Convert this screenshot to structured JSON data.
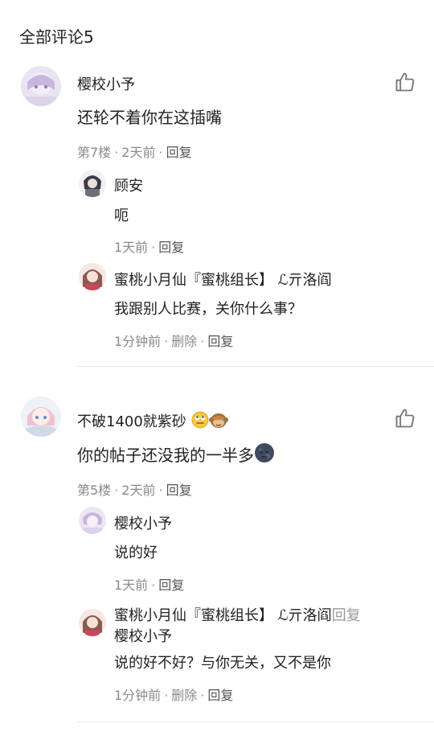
{
  "header": {
    "title": "全部评论5"
  },
  "comments": [
    {
      "user": "樱校小予",
      "text": "还轮不着你在这插嘴",
      "floor": "第7楼",
      "time": "2天前",
      "reply_label": "回复",
      "replies": [
        {
          "user": "顾安",
          "text": "呃",
          "time": "1天前",
          "reply_label": "回复"
        },
        {
          "user": "蜜桃小月仙『蜜桃组长】 ℒ亓洛阎",
          "text": "我跟别人比赛，关你什么事？",
          "time": "1分钟前",
          "delete_label": "删除",
          "reply_label": "回复"
        }
      ]
    },
    {
      "user": "不破1400就紫砂",
      "text": "你的帖子还没我的一半多",
      "floor": "第5楼",
      "time": "2天前",
      "reply_label": "回复",
      "replies": [
        {
          "user": "樱校小予",
          "text": "说的好",
          "time": "1天前",
          "reply_label": "回复"
        },
        {
          "user": "蜜桃小月仙『蜜桃组长】 ℒ亓洛阎",
          "reply_word": "回复",
          "reply_target": "樱校小予",
          "text": "说的好不好？与你无关，又不是你",
          "time": "1分钟前",
          "delete_label": "删除",
          "reply_label": "回复"
        }
      ]
    }
  ],
  "icons": {
    "like": "thumb-up-icon",
    "emoji_roll_eyes": "rolling-eyes-emoji",
    "emoji_monkey": "see-no-evil-monkey-emoji",
    "emoji_moon": "new-moon-face-emoji"
  },
  "colors": {
    "meta": "#8a8a8a",
    "reply_link": "#9a9a9a",
    "text": "#222222"
  }
}
